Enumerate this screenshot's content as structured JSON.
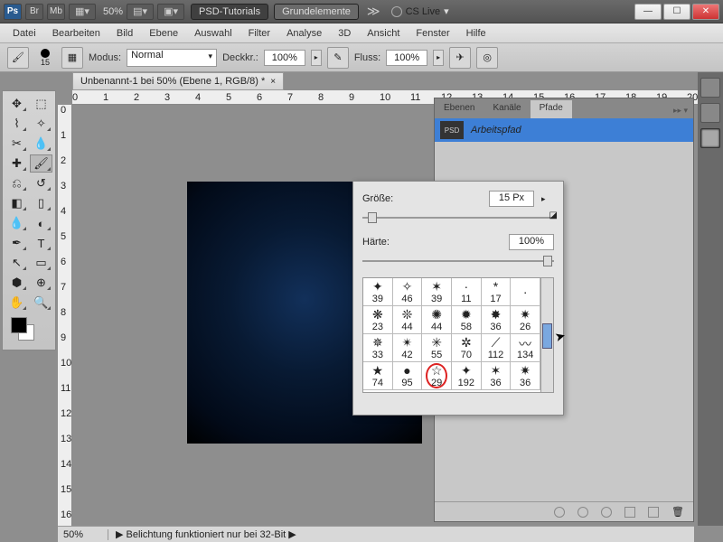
{
  "titlebar": {
    "zoom": "50%",
    "btn1": "PSD-Tutorials",
    "btn2": "Grundelemente",
    "cslive": "CS Live"
  },
  "menu": [
    "Datei",
    "Bearbeiten",
    "Bild",
    "Ebene",
    "Auswahl",
    "Filter",
    "Analyse",
    "3D",
    "Ansicht",
    "Fenster",
    "Hilfe"
  ],
  "opt": {
    "brush_size": "15",
    "modus_lbl": "Modus:",
    "modus_val": "Normal",
    "deck_lbl": "Deckkr.:",
    "deck_val": "100%",
    "fluss_lbl": "Fluss:",
    "fluss_val": "100%"
  },
  "doc": {
    "tab": "Unbenannt-1 bei 50% (Ebene 1, RGB/8) *"
  },
  "ruler_h": [
    "0",
    "1",
    "2",
    "3",
    "4",
    "5",
    "6",
    "7",
    "8",
    "9",
    "10",
    "11",
    "12",
    "13",
    "14",
    "15",
    "16",
    "17",
    "18",
    "19",
    "20"
  ],
  "ruler_v": [
    "0",
    "1",
    "2",
    "3",
    "4",
    "5",
    "6",
    "7",
    "8",
    "9",
    "10",
    "11",
    "12",
    "13",
    "14",
    "15",
    "16"
  ],
  "panel": {
    "tabs": [
      "Ebenen",
      "Kanäle",
      "Pfade"
    ],
    "active": 2,
    "path_name": "Arbeitspfad"
  },
  "brush": {
    "size_lbl": "Größe:",
    "size_val": "15 Px",
    "hard_lbl": "Härte:",
    "hard_val": "100%",
    "row1": [
      39,
      46,
      39,
      11,
      17,
      ""
    ],
    "row2": [
      23,
      44,
      44,
      58,
      36,
      26
    ],
    "row3": [
      33,
      42,
      55,
      70,
      112,
      134
    ],
    "row4": [
      74,
      95,
      29,
      192,
      36,
      36
    ],
    "glyphs4": [
      "★",
      "●",
      "☆",
      "✦",
      "✶",
      "✷"
    ],
    "selected": "29"
  },
  "status": {
    "zoom": "50%",
    "msg": "Belichtung funktioniert nur bei 32-Bit"
  }
}
